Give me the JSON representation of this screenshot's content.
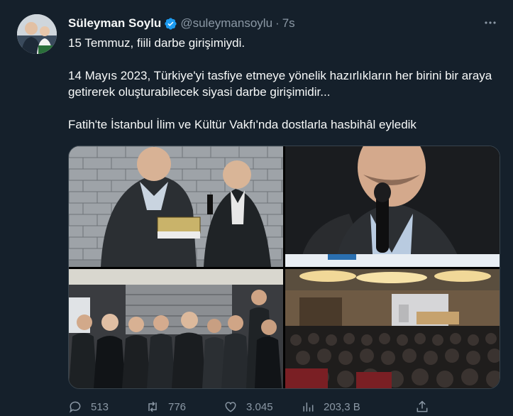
{
  "tweet": {
    "author_name": "Süleyman Soylu",
    "handle": "@suleymansoylu",
    "separator": "·",
    "time": "7s",
    "paragraphs": [
      "15 Temmuz, fiili darbe girişimiydi.",
      "14 Mayıs 2023, Türkiye'yi tasfiye etmeye yönelik hazırlıkların her birini bir araya getirerek oluşturabilecek siyasi darbe girişimidir...",
      "Fatih'te İstanbul İlim ve Kültür Vakfı'nda dostlarla hasbihâl eyledik"
    ],
    "media_count": 4
  },
  "actions": {
    "replies": "513",
    "retweets": "776",
    "likes": "3.045",
    "views": "203,3 B"
  },
  "icons": {
    "verified": "verified-badge-icon",
    "more": "more-options-icon",
    "reply": "reply-icon",
    "retweet": "retweet-icon",
    "like": "heart-icon",
    "views": "views-chart-icon",
    "share": "share-icon"
  },
  "colors": {
    "background": "#15202b",
    "text": "#f7f9f9",
    "secondary": "#8b98a5",
    "verified": "#1d9bf0",
    "border": "#38444d"
  }
}
